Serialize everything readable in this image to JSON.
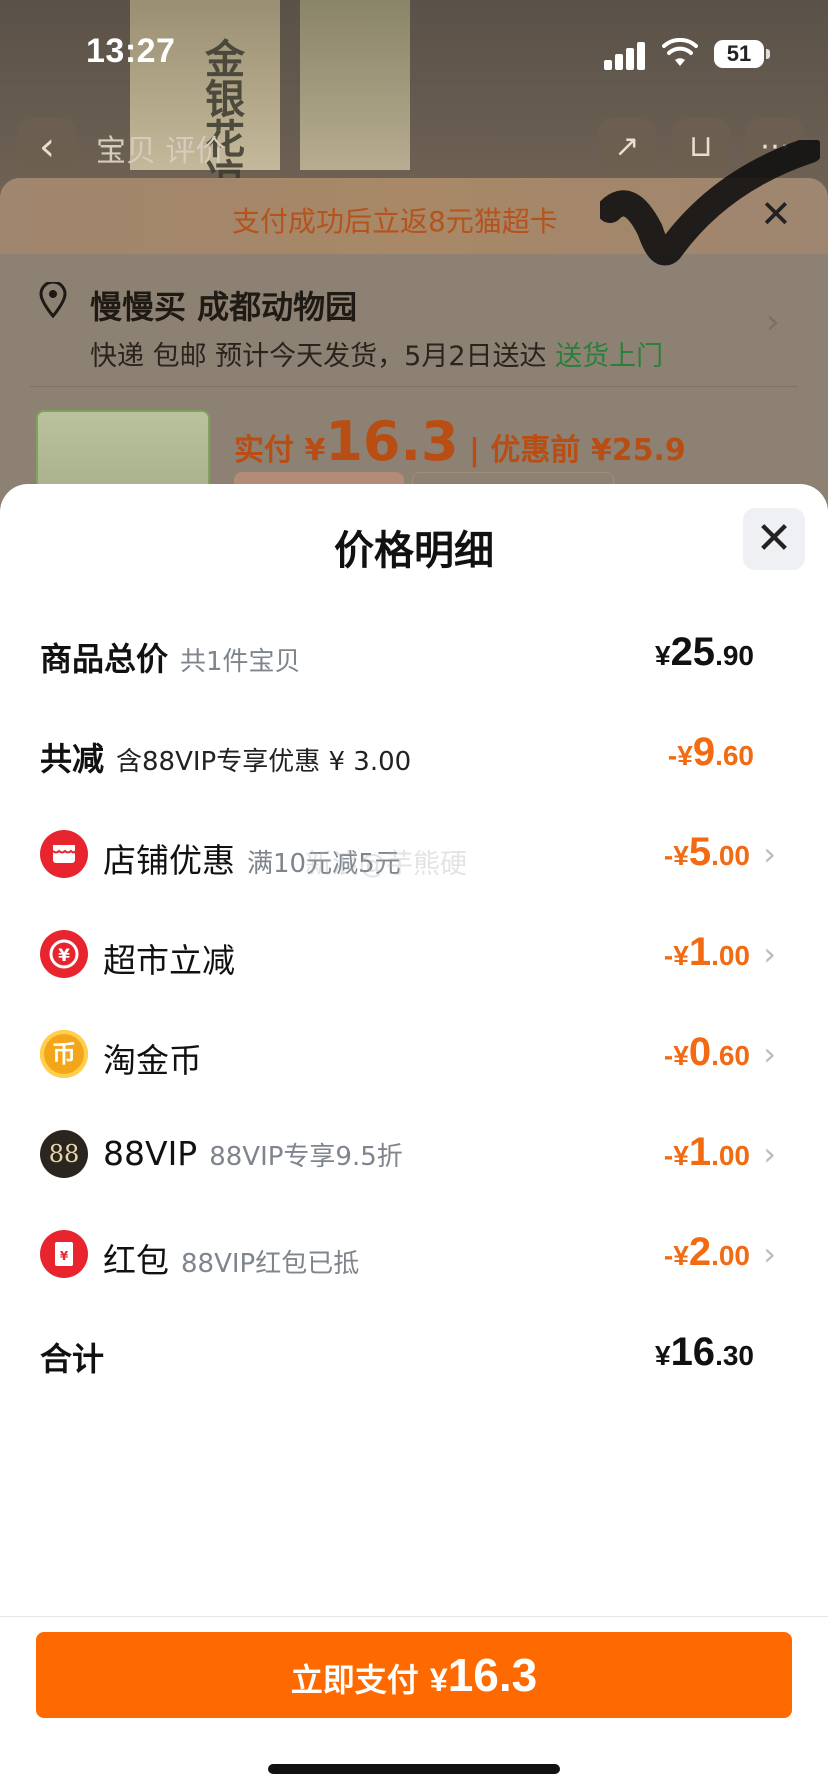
{
  "status_bar": {
    "time": "13:27",
    "battery": "51"
  },
  "background": {
    "package_text": "金银花凉茶",
    "nav_title": "宝贝  评价",
    "banner_text": "支付成功后立返8元猫超卡",
    "address": "慢慢买 成都动物园",
    "shipping_prefix": "快递 包邮 预计今天发货，5月2日送达",
    "shipping_green": "送货上门",
    "price_label": "实付 ¥",
    "price_big": "16.3",
    "price_before": "| 优惠前 ¥25.9"
  },
  "sheet": {
    "title": "价格明细",
    "close_icon": "close-icon",
    "watermark": "新浪@芋熊硬",
    "rows": [
      {
        "label": "商品总价",
        "sub": "共1件宝贝",
        "currency": "¥",
        "amount_main": "25",
        "amount_dec": ".90",
        "color": "#111111"
      },
      {
        "label": "共减",
        "sub": "含88VIP专享优惠 ¥ 3.00",
        "currency": "-¥",
        "amount_main": "9",
        "amount_dec": ".60",
        "color": "#f26a12"
      },
      {
        "label": "店铺优惠",
        "sub": "满10元减5元",
        "icon": "shop-icon",
        "icon_color": "#e8242e",
        "currency": "-¥",
        "amount_main": "5",
        "amount_dec": ".00"
      },
      {
        "label": "超市立减",
        "icon": "supermarket-yen-icon",
        "icon_color": "#e8242e",
        "currency": "-¥",
        "amount_main": "1",
        "amount_dec": ".00"
      },
      {
        "label": "淘金币",
        "icon": "coin-icon",
        "icon_glyph": "币",
        "icon_color": "#f4a61a",
        "currency": "-¥",
        "amount_main": "0",
        "amount_dec": ".60"
      },
      {
        "label": "88VIP",
        "sub": "88VIP专享9.5折",
        "icon": "vip88-icon",
        "icon_glyph": "88",
        "icon_color": "#2b2520",
        "currency": "-¥",
        "amount_main": "1",
        "amount_dec": ".00"
      },
      {
        "label": "红包",
        "sub": "88VIP红包已抵",
        "icon": "red-packet-icon",
        "icon_glyph": "¥",
        "icon_color": "#e8242e",
        "currency": "-¥",
        "amount_main": "2",
        "amount_dec": ".00"
      },
      {
        "label": "合计",
        "currency": "¥",
        "amount_main": "16",
        "amount_dec": ".30",
        "color": "#111111"
      }
    ],
    "pay_button": {
      "label": "立即支付",
      "currency": "¥",
      "amount": "16.3"
    }
  }
}
